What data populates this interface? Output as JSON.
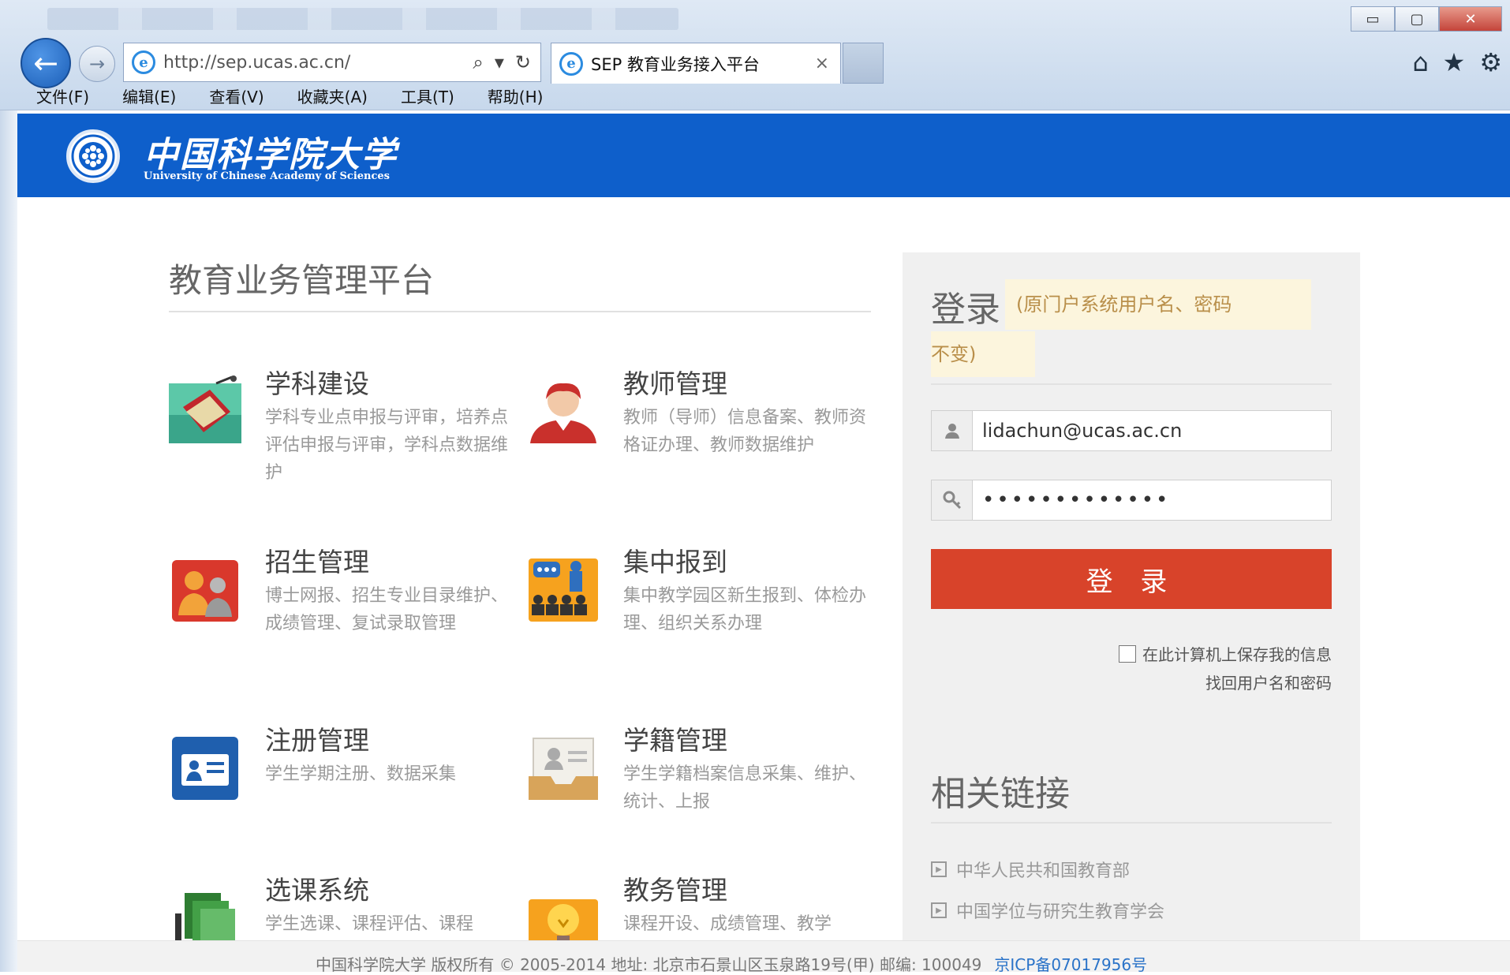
{
  "browser": {
    "address": "http://sep.ucas.ac.cn/",
    "tab_title": "SEP 教育业务接入平台",
    "tab_close": "×",
    "menu": [
      "文件(F)",
      "编辑(E)",
      "查看(V)",
      "收藏夹(A)",
      "工具(T)",
      "帮助(H)"
    ],
    "window_controls": {
      "minimize": "▭",
      "maximize": "▢",
      "close": "✕"
    }
  },
  "header": {
    "brand_cn": "中国科学院大学",
    "brand_en": "University of Chinese Academy of Sciences"
  },
  "main": {
    "title": "教育业务管理平台",
    "modules": [
      {
        "title": "学科建设",
        "desc": "学科专业点申报与评审，培养点评估申报与评审，学科点数据维护",
        "icon": "discipline-book-icon"
      },
      {
        "title": "教师管理",
        "desc": "教师（导师）信息备案、教师资格证办理、教师数据维护",
        "icon": "teacher-avatar-icon"
      },
      {
        "title": "招生管理",
        "desc": "博士网报、招生专业目录维护、成绩管理、复试录取管理",
        "icon": "enrollment-people-icon"
      },
      {
        "title": "集中报到",
        "desc": "集中教学园区新生报到、体检办理、组织关系办理",
        "icon": "checkin-audience-icon"
      },
      {
        "title": "注册管理",
        "desc": "学生学期注册、数据采集",
        "icon": "id-card-icon"
      },
      {
        "title": "学籍管理",
        "desc": "学生学籍档案信息采集、维护、统计、上报",
        "icon": "student-record-icon"
      },
      {
        "title": "选课系统",
        "desc": "学生选课、课程评估、课程",
        "icon": "course-selection-icon"
      },
      {
        "title": "教务管理",
        "desc": "课程开设、成绩管理、教学",
        "icon": "academic-bulb-icon"
      }
    ]
  },
  "login": {
    "title": "登录",
    "note_line1": "(原门户系统用户名、密码",
    "note_line2": "不变)",
    "username_value": "lidachun@ucas.ac.cn",
    "password_value": "•••••••••••••",
    "button_label": "登 录",
    "remember_label": "在此计算机上保存我的信息",
    "recover_label": "找回用户名和密码"
  },
  "links": {
    "title": "相关链接",
    "items": [
      "中华人民共和国教育部",
      "中国学位与研究生教育学会"
    ]
  },
  "footer": {
    "text": "中国科学院大学 版权所有 © 2005-2014 地址: 北京市石景山区玉泉路19号(甲) 邮编: 100049",
    "icp": "京ICP备07017956号"
  },
  "colors": {
    "brand_blue": "#0e5fcb",
    "login_red": "#d8432a",
    "note_bg": "#fcf5dd"
  }
}
